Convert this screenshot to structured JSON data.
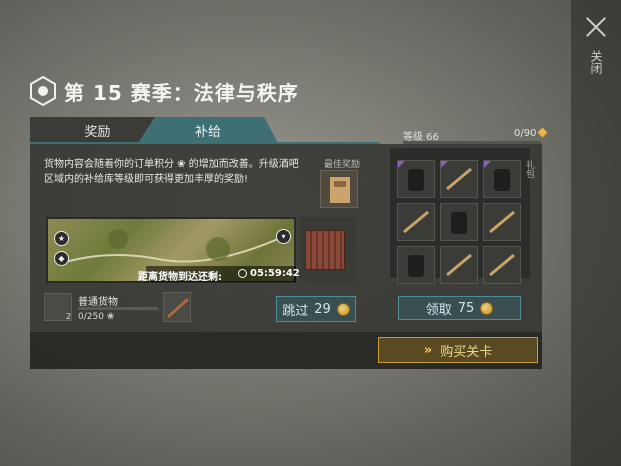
{
  "header": {
    "title": "第 15 赛季：法律与秩序"
  },
  "side": {
    "close_label": "关闭"
  },
  "tabs": [
    {
      "label": "奖励"
    },
    {
      "label": "补给"
    }
  ],
  "level": {
    "label": "等级 66",
    "progress": "0/90",
    "progress_fraction": 0.0
  },
  "supply": {
    "description": "货物内容会随着你的订单积分 ❀ 的增加而改善。升级酒吧区域内的补给库等级即可获得更加丰厚的奖励!",
    "best_reward_label": "最佳奖励",
    "timer_label": "距离货物到达还剩:",
    "timer_value": "05:59:42",
    "cargo_name": "普通货物",
    "cargo_badge": "2",
    "cargo_progress": "0/250 ❀",
    "skip_label": "跳过",
    "skip_cost": "29"
  },
  "rewards": {
    "gift_label": "礼包",
    "items": [
      {
        "icon": "backpack-icon",
        "rare": true
      },
      {
        "icon": "rifle-icon",
        "rare": true
      },
      {
        "icon": "backpack-icon",
        "rare": true
      },
      {
        "icon": "rifle-icon",
        "rare": false
      },
      {
        "icon": "backpack-icon",
        "rare": false
      },
      {
        "icon": "rifle-icon",
        "rare": false
      },
      {
        "icon": "backpack-icon",
        "rare": false
      },
      {
        "icon": "rifle-icon",
        "rare": false
      },
      {
        "icon": "rifle-icon",
        "rare": false
      }
    ],
    "claim_label": "领取",
    "claim_cost": "75"
  },
  "footer": {
    "buy_label": "购买关卡"
  },
  "colors": {
    "accent": "#3d6f74",
    "gold": "#c89a35",
    "rare": "#8a5fc0"
  }
}
